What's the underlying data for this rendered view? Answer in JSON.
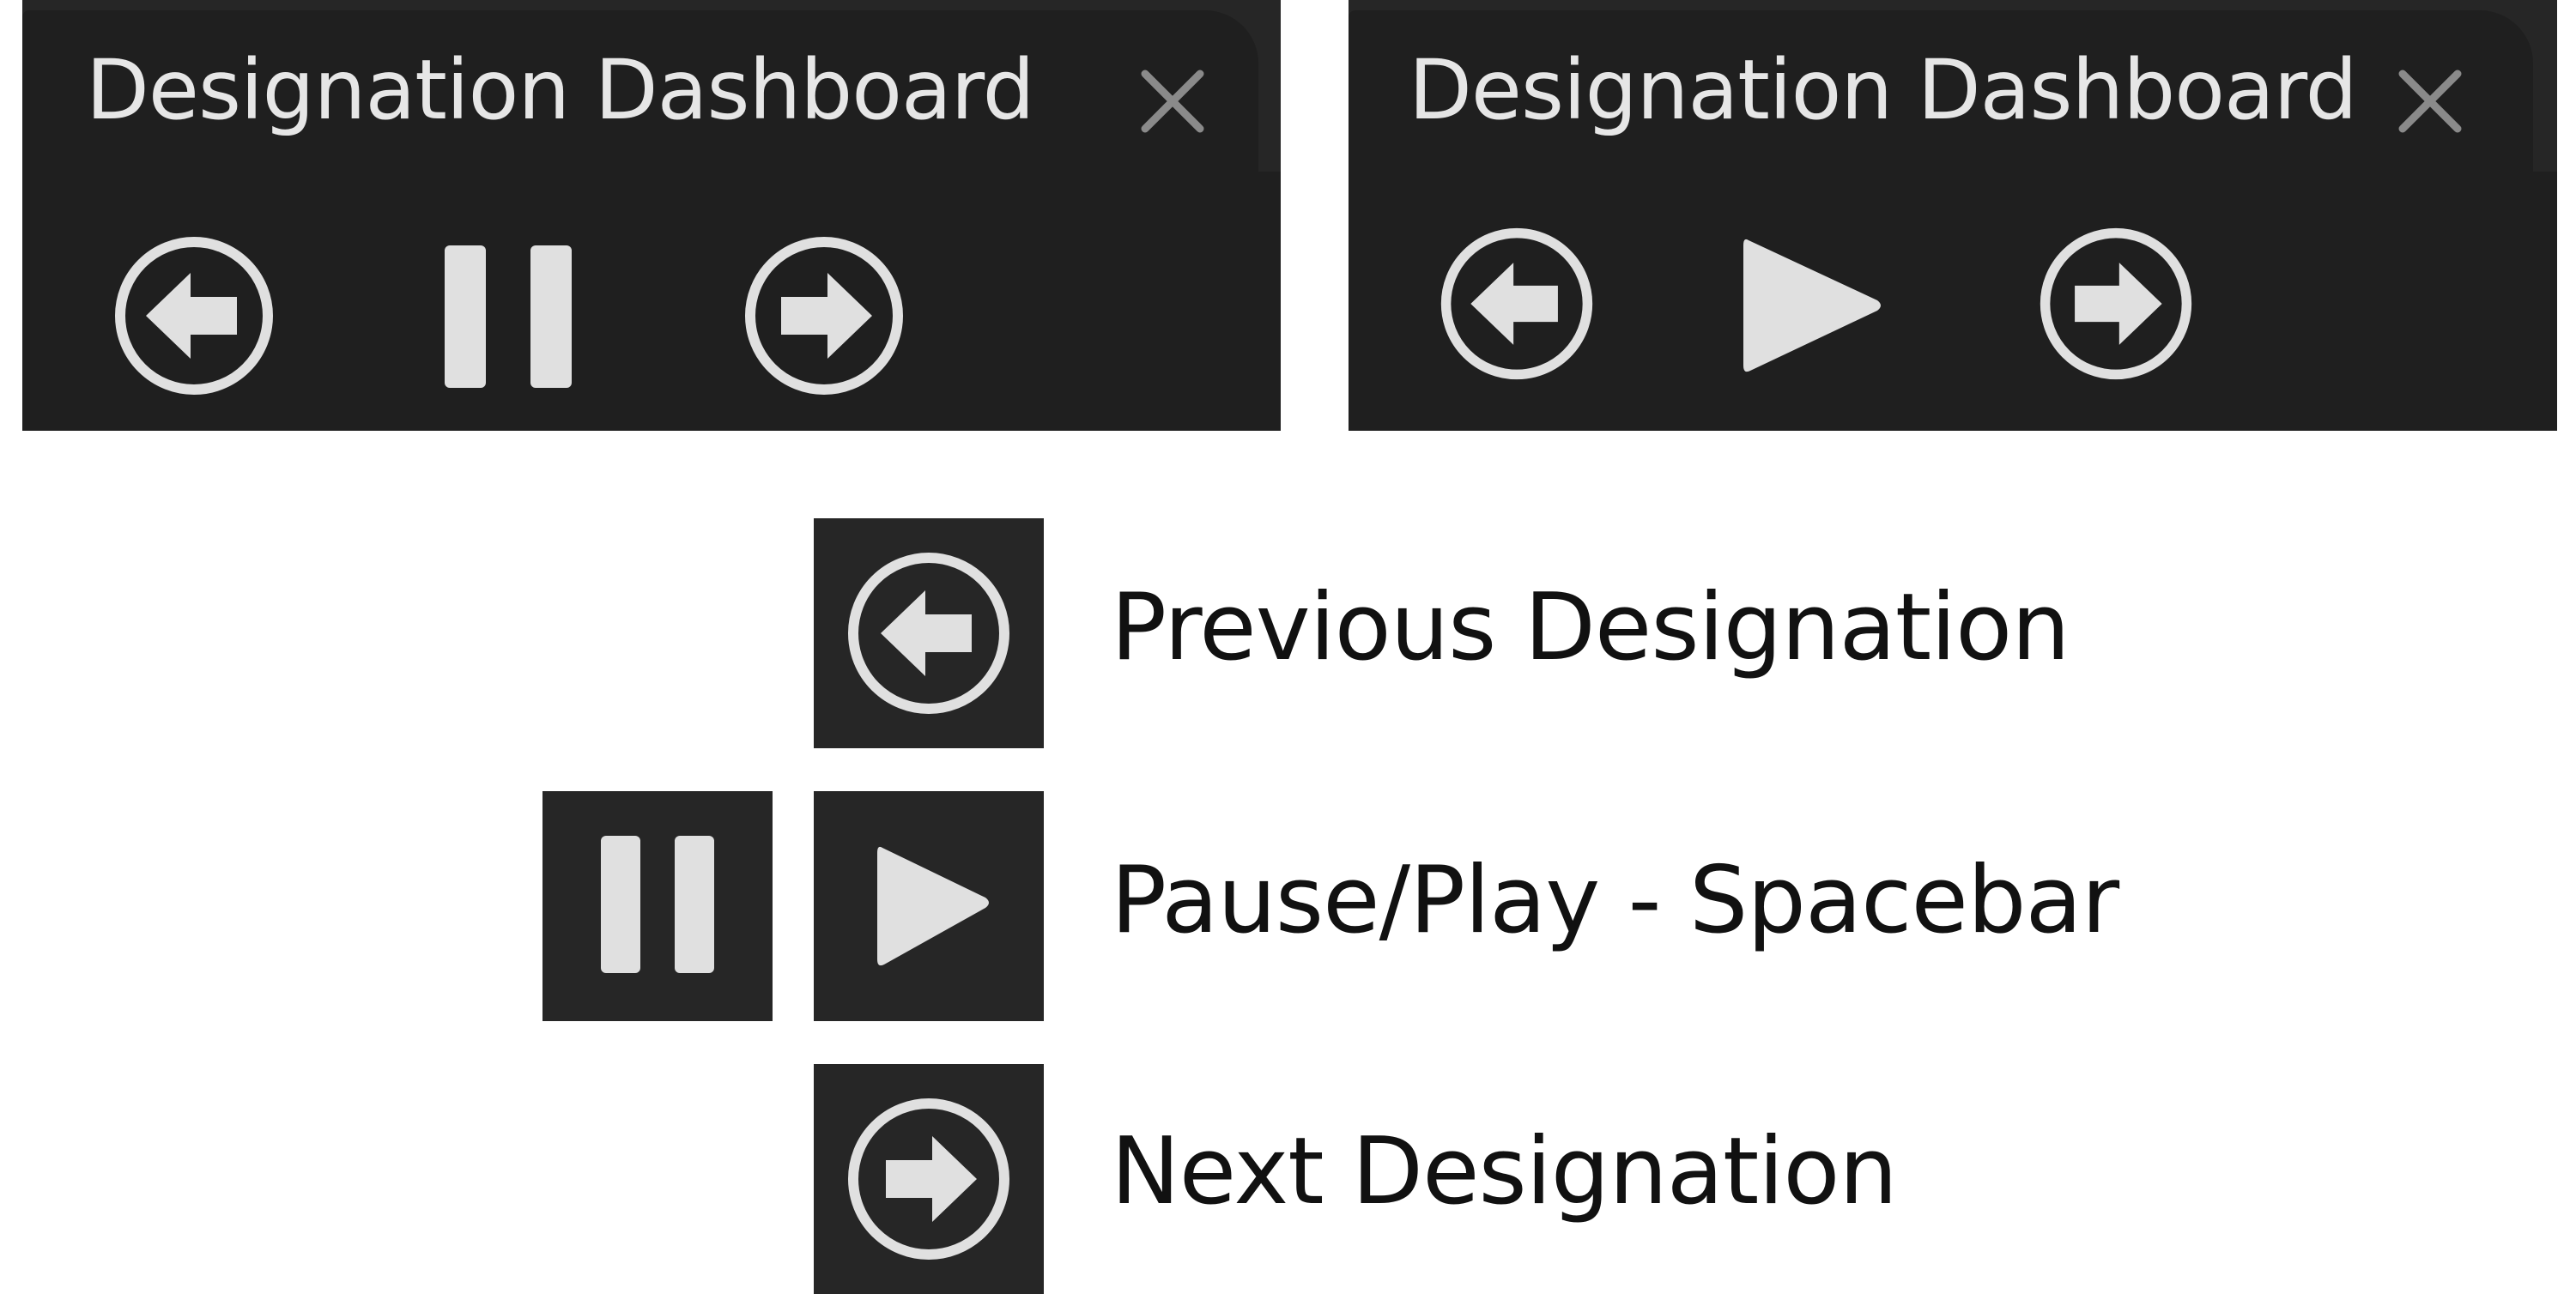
{
  "panels": [
    {
      "tab_title": "Designation Dashboard",
      "close_icon": "close-icon",
      "controls": [
        "previous-icon",
        "pause-icon",
        "next-icon"
      ]
    },
    {
      "tab_title": "Designation Dashboard",
      "close_icon": "close-icon",
      "controls": [
        "previous-icon",
        "play-icon",
        "next-icon"
      ]
    }
  ],
  "legend": {
    "previous_label": "Previous Designation",
    "pause_play_label": "Pause/Play - Spacebar",
    "next_label": "Next Designation"
  },
  "colors": {
    "panel_bg": "#262626",
    "tab_bg": "#1f1f1f",
    "icon": "#e0e0e0",
    "text_dark": "#111111"
  }
}
